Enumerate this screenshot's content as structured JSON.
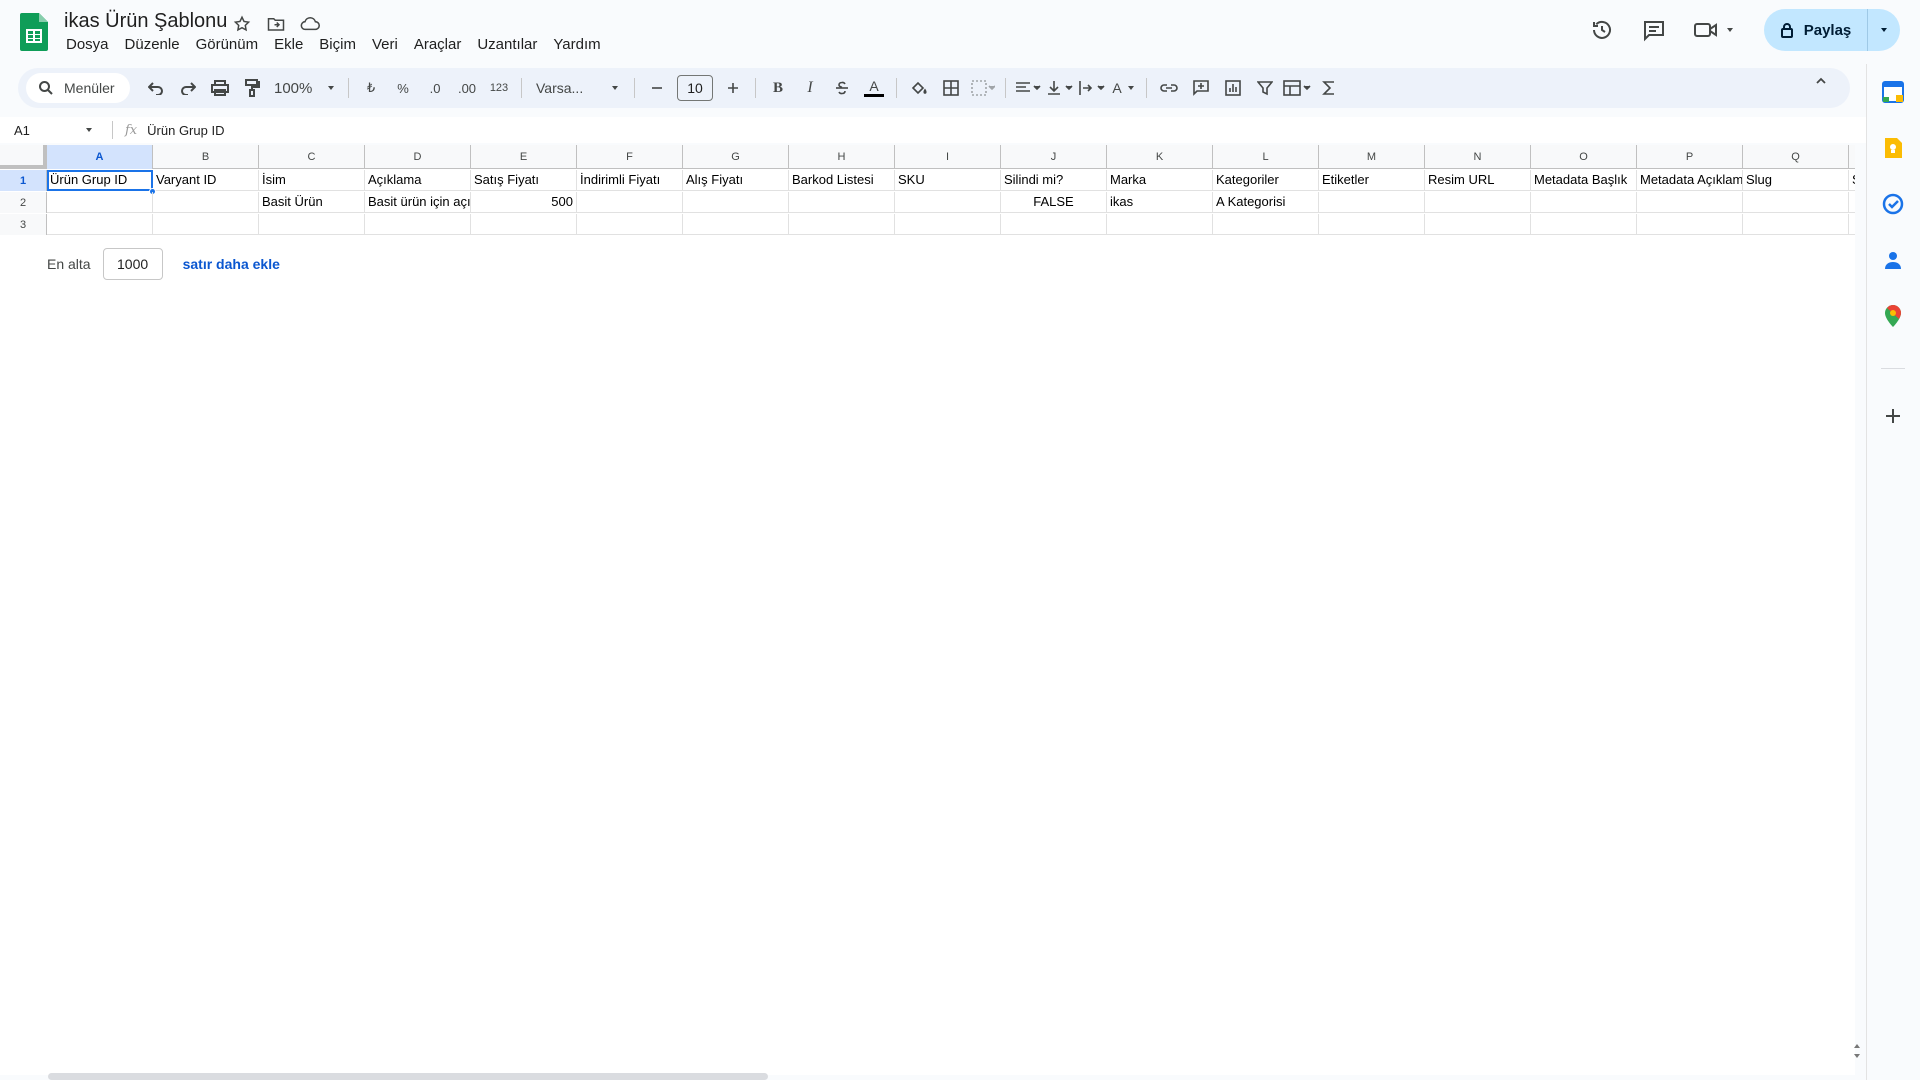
{
  "doc": {
    "title": "ikas Ürün Şablonu"
  },
  "menu": [
    "Dosya",
    "Düzenle",
    "Görünüm",
    "Ekle",
    "Biçim",
    "Veri",
    "Araçlar",
    "Uzantılar",
    "Yardım"
  ],
  "header": {
    "share_label": "Paylaş"
  },
  "toolbar": {
    "search_label": "Menüler",
    "zoom": "100%",
    "currency": "₺",
    "percent": "%",
    "dec_decrease": ".0",
    "dec_increase": ".00",
    "number_format": "123",
    "font": "Varsa...",
    "font_size": "10",
    "bold": "B",
    "italic": "I",
    "text_color": "A",
    "text_rotate": "A"
  },
  "formula_bar": {
    "cell_ref": "A1",
    "fx": "fx",
    "value": "Ürün Grup ID"
  },
  "grid": {
    "columns": [
      "A",
      "B",
      "C",
      "D",
      "E",
      "F",
      "G",
      "H",
      "I",
      "J",
      "K",
      "L",
      "M",
      "N",
      "O",
      "P",
      "Q"
    ],
    "row_numbers": [
      "1",
      "2",
      "3"
    ],
    "rows": [
      [
        "Ürün Grup ID",
        "Varyant ID",
        "İsim",
        "Açıklama",
        "Satış Fiyatı",
        "İndirimli Fiyatı",
        "Alış Fiyatı",
        "Barkod Listesi",
        "SKU",
        "Silindi mi?",
        "Marka",
        "Kategoriler",
        "Etiketler",
        "Resim URL",
        "Metadata Başlık",
        "Metadata Açıklama",
        "Slug"
      ],
      [
        "",
        "",
        "Basit Ürün",
        "Basit ürün için açıklama",
        "500",
        "",
        "",
        "",
        "",
        "FALSE",
        "ikas",
        "A Kategorisi",
        "",
        "",
        "",
        "",
        ""
      ],
      [
        "",
        "",
        "",
        "",
        "",
        "",
        "",
        "",
        "",
        "",
        "",
        "",
        "",
        "",
        "",
        "",
        ""
      ]
    ],
    "overflow_letter": "S"
  },
  "add_rows": {
    "label": "En alta",
    "count": "1000",
    "link": "satır daha ekle"
  },
  "colors": {
    "accent": "#1a73e8",
    "share_bg": "#c2e7ff",
    "sheets_green": "#0f9d58"
  }
}
